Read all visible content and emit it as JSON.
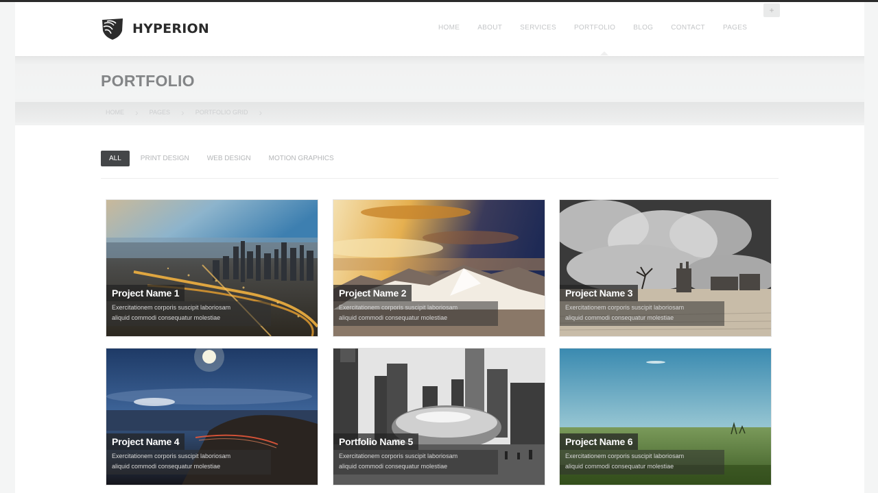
{
  "header": {
    "brand": "HYPERION",
    "nav": [
      "HOME",
      "ABOUT",
      "SERVICES",
      "PORTFOLIO",
      "BLOG",
      "CONTACT",
      "PAGES"
    ],
    "active_nav": "PORTFOLIO"
  },
  "page": {
    "title": "PORTFOLIO",
    "breadcrumbs": [
      "HOME",
      "PAGES",
      "PORTFOLIO GRID"
    ]
  },
  "filters": [
    "ALL",
    "PRINT DESIGN",
    "WEB DESIGN",
    "MOTION GRAPHICS"
  ],
  "active_filter": "ALL",
  "projects": [
    {
      "title": "Project Name 1",
      "desc": [
        "Exercitationem corporis suscipit laboriosam",
        "aliquid commodi consequatur molestiae"
      ],
      "image": "city-night-aerial"
    },
    {
      "title": "Project Name 2",
      "desc": [
        "Exercitationem corporis suscipit laboriosam",
        "aliquid commodi consequatur molestiae"
      ],
      "image": "sunset-snowy-mountains"
    },
    {
      "title": "Project Name 3",
      "desc": [
        "Exercitationem corporis suscipit laboriosam",
        "aliquid commodi consequatur molestiae"
      ],
      "image": "smoke-cloud-ruins"
    },
    {
      "title": "Project Name 4",
      "desc": [
        "Exercitationem corporis suscipit laboriosam",
        "aliquid commodi consequatur molestiae"
      ],
      "image": "moonlit-coast-road"
    },
    {
      "title": "Portfolio Name 5",
      "desc": [
        "Exercitationem corporis suscipit laboriosam",
        "aliquid commodi consequatur molestiae"
      ],
      "image": "city-bean-sculpture"
    },
    {
      "title": "Project Name 6",
      "desc": [
        "Exercitationem corporis suscipit laboriosam",
        "aliquid commodi consequatur molestiae"
      ],
      "image": "green-field-sky"
    }
  ],
  "colors": {
    "brand_dark": "#2a2a2a",
    "active_filter_bg": "#444648",
    "caption_bg": "#222222"
  }
}
